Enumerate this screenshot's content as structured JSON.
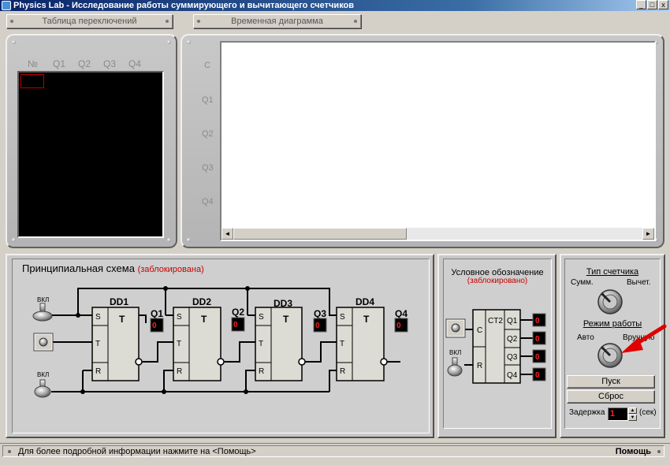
{
  "window": {
    "title": "Physics Lab - Исследование работы суммирующего и вычитающего счетчиков",
    "minimize": "_",
    "maximize": "□",
    "close": "x"
  },
  "tabs": {
    "switch_table": "Таблица переключений",
    "timing_diagram": "Временная диаграмма"
  },
  "switch_table": {
    "columns": [
      "№",
      "Q1",
      "Q2",
      "Q3",
      "Q4"
    ]
  },
  "timing": {
    "rows": [
      "C",
      "Q1",
      "Q2",
      "Q3",
      "Q4"
    ],
    "scroll_left": "◄",
    "scroll_right": "►"
  },
  "schematic": {
    "title": "Принципиальная схема",
    "locked": "(заблокирована)",
    "switch_label": "ВКЛ",
    "triggers": [
      {
        "name": "DD1",
        "out": "Q1",
        "value": "0"
      },
      {
        "name": "DD2",
        "out": "Q2",
        "value": "0"
      },
      {
        "name": "DD3",
        "out": "Q3",
        "value": "0"
      },
      {
        "name": "DD4",
        "out": "Q4",
        "value": "0"
      }
    ],
    "pins": {
      "s": "S",
      "t": "T",
      "r": "R",
      "body": "T"
    }
  },
  "symbol": {
    "title": "Условное обозначение",
    "locked": "(заблокировано)",
    "chip": "CT2",
    "in_c": "C",
    "in_r": "R",
    "switch_label": "ВКЛ",
    "outputs": [
      {
        "name": "Q1",
        "value": "0"
      },
      {
        "name": "Q2",
        "value": "0"
      },
      {
        "name": "Q3",
        "value": "0"
      },
      {
        "name": "Q4",
        "value": "0"
      }
    ]
  },
  "controls": {
    "counter_type_title": "Тип счетчика",
    "sum_label": "Сумм.",
    "sub_label": "Вычет.",
    "mode_title": "Режим работы",
    "auto_label": "Авто",
    "manual_label": "Вручную",
    "start_button": "Пуск",
    "reset_button": "Сброс",
    "delay_label": "Задержка",
    "delay_value": "1",
    "delay_unit": "(сек)"
  },
  "status": {
    "message": "Для более подробной информации нажмите на <Помощь>",
    "help": "Помощь"
  },
  "colors": {
    "title_bar": "#0a246a",
    "led_digit": "#ff2020",
    "locked_text": "#cc0000",
    "arrow": "#e00000"
  }
}
